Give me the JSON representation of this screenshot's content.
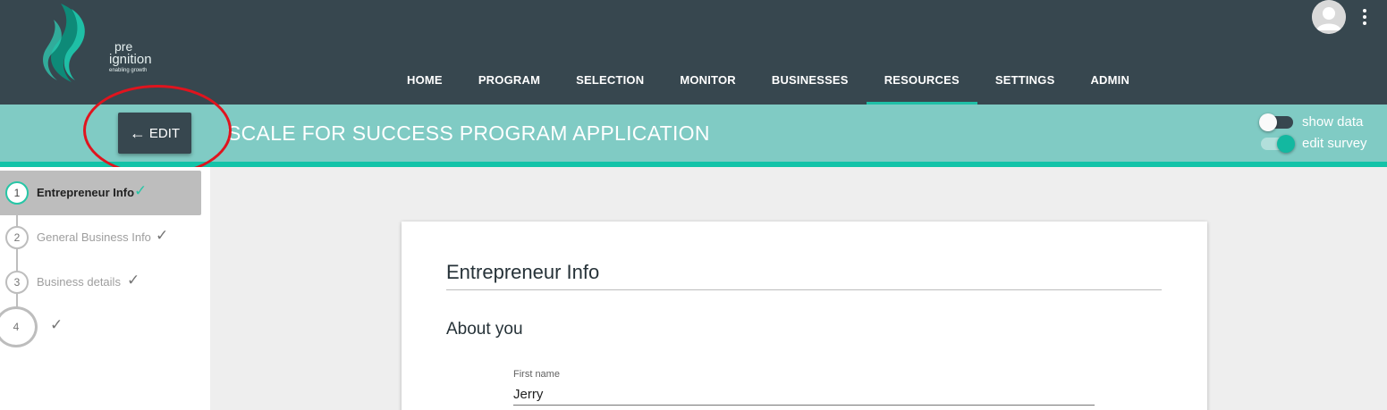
{
  "logo": {
    "line1": "pre",
    "line2": "ignition",
    "tagline": "enabling    growth",
    "colors": {
      "swoosh_dark": "#0e8a78",
      "swoosh_light": "#1fbfa6"
    }
  },
  "nav": {
    "items": [
      {
        "label": "HOME"
      },
      {
        "label": "PROGRAM"
      },
      {
        "label": "SELECTION"
      },
      {
        "label": "MONITOR"
      },
      {
        "label": "BUSINESSES"
      },
      {
        "label": "RESOURCES",
        "active": true
      },
      {
        "label": "SETTINGS"
      },
      {
        "label": "ADMIN"
      }
    ]
  },
  "header": {
    "edit_button": {
      "label": "EDIT",
      "icon": "arrow-left-icon"
    },
    "title": "SCALE FOR SUCCESS PROGRAM APPLICATION",
    "toggles": {
      "show_data": {
        "label": "show data",
        "on": false
      },
      "edit_survey": {
        "label": "edit survey",
        "on": true
      }
    }
  },
  "stepper": {
    "steps": [
      {
        "number": "1",
        "label": "Entrepreneur Info",
        "active": true
      },
      {
        "number": "2",
        "label": "General Business Info"
      },
      {
        "number": "3",
        "label": "Business details"
      },
      {
        "number": "4",
        "label": ""
      }
    ]
  },
  "form": {
    "section_title": "Entrepreneur Info",
    "subsection_title": "About you",
    "first_name": {
      "label": "First name",
      "value": "Jerry"
    }
  },
  "colors": {
    "navbar": "#37474f",
    "band": "#80cbc4",
    "accent": "#13c3a8",
    "annotation": "#e0141e"
  }
}
